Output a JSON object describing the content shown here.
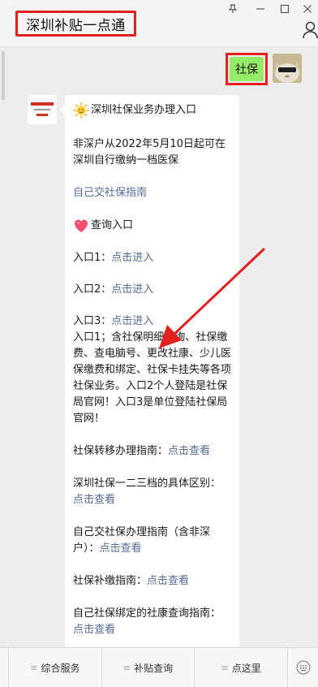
{
  "window": {
    "title": "深圳补贴一点通",
    "controls": {
      "pin": "⊥",
      "minimize": "—",
      "maximize": "☐",
      "close": "✕"
    }
  },
  "chat": {
    "user_message": "社保",
    "bot_message": {
      "header": "深圳社保业务办理入口",
      "intro": "非深户从2022年5月10日起可在深圳自行缴纳一档医保",
      "link_self_guide": "自己交社保指南",
      "query_title": "查询入口",
      "entries": [
        {
          "label": "入口1：",
          "link": "点击进入"
        },
        {
          "label": "入口2：",
          "link": "点击进入"
        },
        {
          "label": "入口3：",
          "link": "点击进入"
        }
      ],
      "entry_desc": "入口1；含社保明细查询、社保缴费、查电脑号、更改社康、少儿医保缴费和绑定、社保卡挂失等各项社保业务。入口2个人登陆是社保局官网！入口3是单位登陆社保局官网！",
      "guides": [
        {
          "text": "社保转移办理指南：",
          "link": "点击查看"
        },
        {
          "text": "深圳社保一二三档的具体区别：",
          "link": "点击查看"
        },
        {
          "text": "自己交社保办理指南（含非深户）：",
          "link": "点击查看"
        },
        {
          "text": "社保补缴指南：",
          "link": "点击查看"
        },
        {
          "text": "自己社保绑定的社康查询指南：",
          "link": "点击查看"
        }
      ]
    }
  },
  "menu": {
    "items": [
      {
        "icon": "≡",
        "label": "综合服务"
      },
      {
        "icon": "≡",
        "label": "补贴查询"
      },
      {
        "icon": "≡",
        "label": "点这里"
      }
    ]
  },
  "colors": {
    "highlight_red": "#e32020",
    "user_bubble": "#95ec69",
    "link": "#576b95",
    "chat_bg": "#ededed"
  }
}
